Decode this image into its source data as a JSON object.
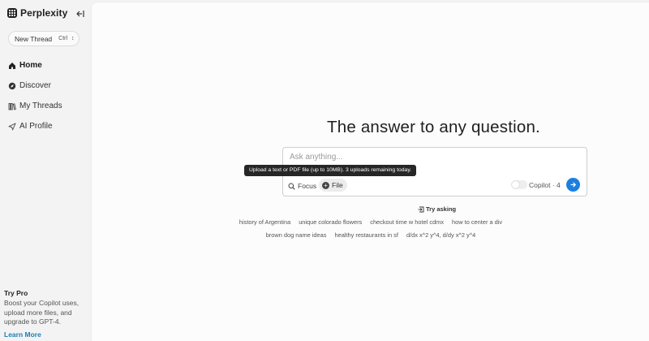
{
  "sidebar": {
    "brand": "Perplexity",
    "new_thread": {
      "label": "New Thread",
      "shortcut": "Ctrl",
      "shortcut_icon": "up-down-icon"
    },
    "nav": [
      {
        "label": "Home",
        "icon": "home-icon",
        "active": true
      },
      {
        "label": "Discover",
        "icon": "compass-icon",
        "active": false
      },
      {
        "label": "My Threads",
        "icon": "library-icon",
        "active": false
      },
      {
        "label": "AI Profile",
        "icon": "send-icon",
        "active": false
      }
    ],
    "try_pro": {
      "title": "Try Pro",
      "description": "Boost your Copilot uses, upload more files, and upgrade to GPT-4.",
      "link": "Learn More"
    }
  },
  "main": {
    "headline": "The answer to any question.",
    "ask": {
      "placeholder": "Ask anything...",
      "focus_label": "Focus",
      "file_label": "File",
      "copilot_label": "Copilot · 4",
      "copilot_enabled": false
    },
    "tooltip": "Upload a text or PDF file (up to 10MB). 3 uploads remaining today.",
    "try_asking": "Try asking",
    "suggestions_row1": [
      "history of Argentina",
      "unique colorado flowers",
      "checkout time w hotel cdmx",
      "how to center a div"
    ],
    "suggestions_row2": [
      "brown dog name ideas",
      "healthy restaurants in sf",
      "d/dx x^2 y^4, d/dy x^2 y^4"
    ]
  },
  "colors": {
    "accent": "#1c7fe0",
    "link": "#1a7fb5",
    "tooltip_bg": "#262626"
  }
}
